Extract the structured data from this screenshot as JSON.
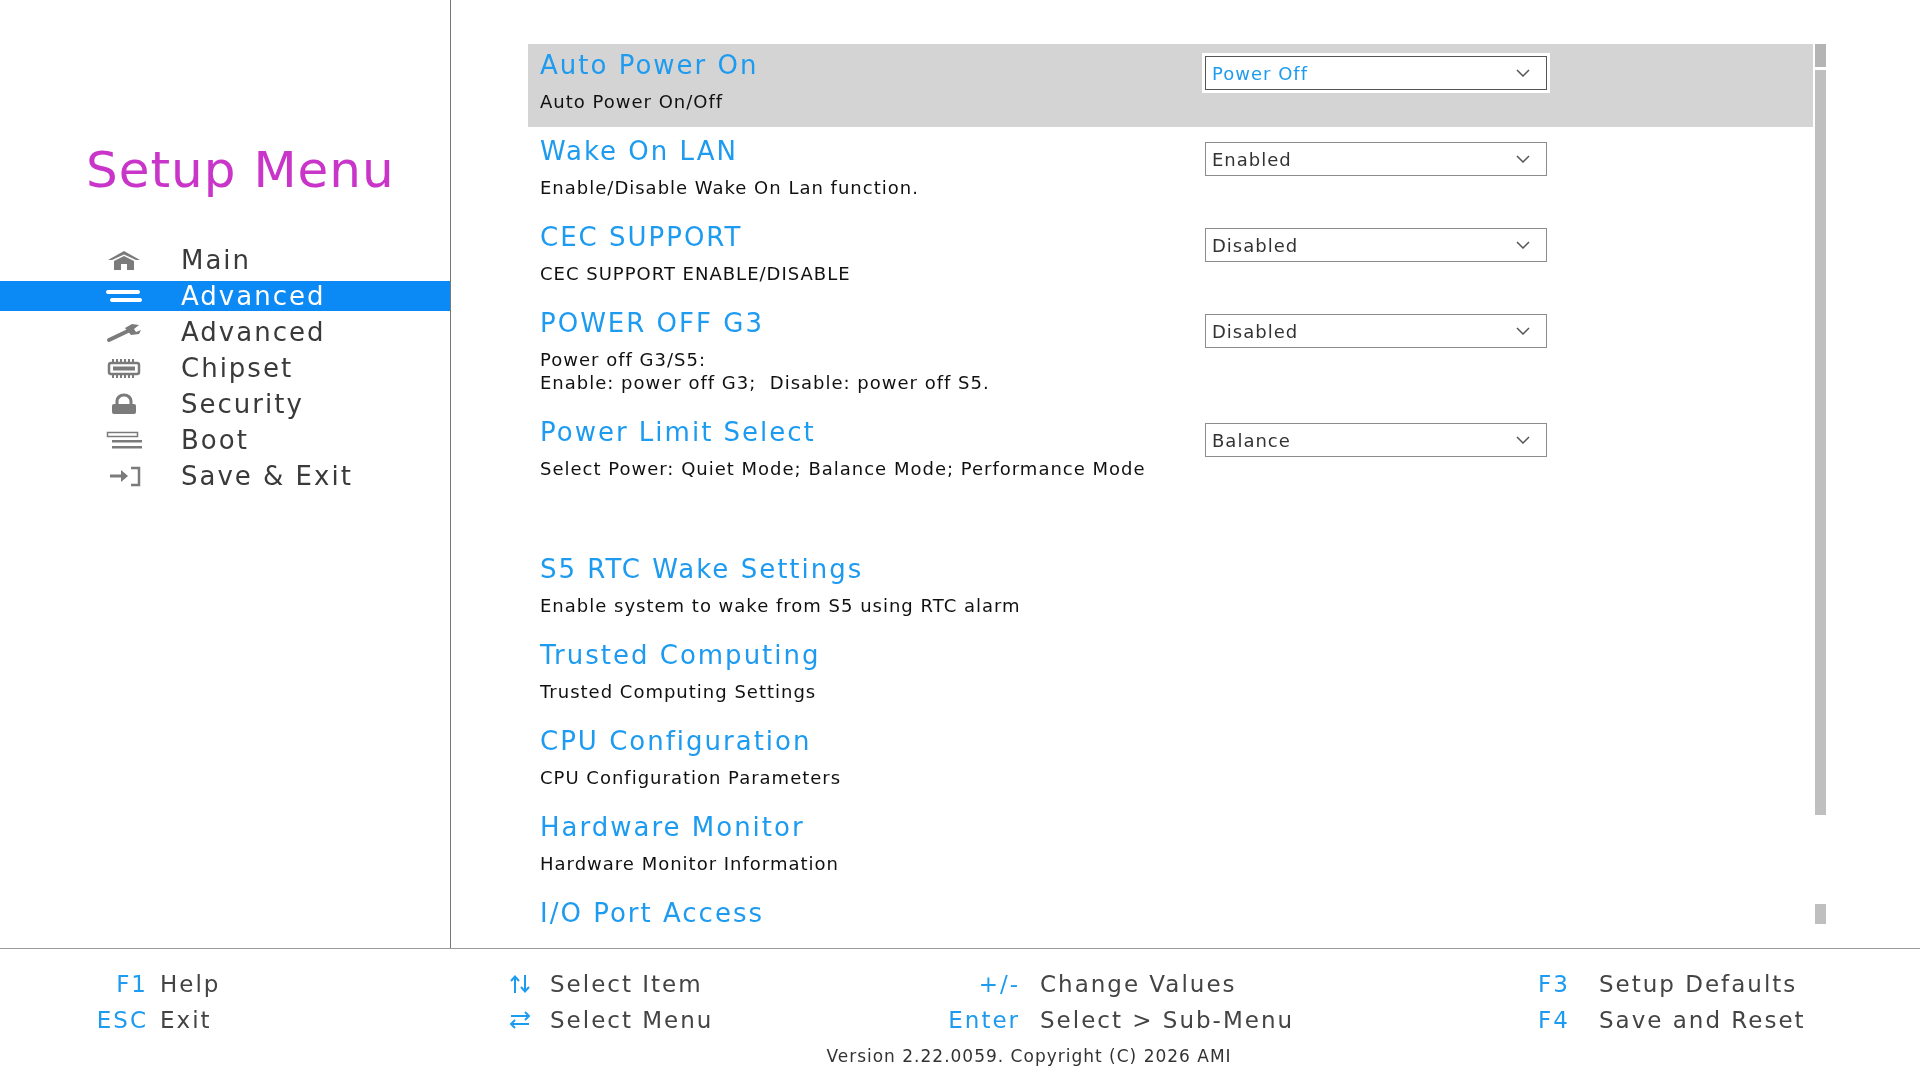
{
  "sidebar": {
    "title": "Setup Menu",
    "items": [
      {
        "label": "Main",
        "selected": false
      },
      {
        "label": "Advanced",
        "selected": true
      },
      {
        "label": "Advanced",
        "selected": false
      },
      {
        "label": "Chipset",
        "selected": false
      },
      {
        "label": "Security",
        "selected": false
      },
      {
        "label": "Boot",
        "selected": false
      },
      {
        "label": "Save & Exit",
        "selected": false
      }
    ]
  },
  "main": {
    "items": [
      {
        "kind": "setting",
        "title": "Auto Power On",
        "description": [
          "Auto Power On/Off"
        ],
        "value": "Power Off",
        "selected": true
      },
      {
        "kind": "setting",
        "title": "Wake On LAN",
        "description": [
          "Enable/Disable Wake On Lan function."
        ],
        "value": "Enabled",
        "selected": false
      },
      {
        "kind": "setting",
        "title": "CEC SUPPORT",
        "description": [
          "CEC SUPPORT ENABLE/DISABLE"
        ],
        "value": "Disabled",
        "selected": false
      },
      {
        "kind": "setting",
        "title": "POWER OFF G3",
        "description": [
          "Power off G3/S5:",
          "Enable: power off G3;  Disable: power off S5."
        ],
        "value": "Disabled",
        "selected": false
      },
      {
        "kind": "setting",
        "title": "Power Limit Select",
        "description": [
          "Select Power: Quiet Mode; Balance Mode; Performance Mode"
        ],
        "value": "Balance",
        "selected": false
      },
      {
        "kind": "submenu",
        "title": "S5 RTC Wake Settings",
        "description": [
          "Enable system to wake from S5 using RTC alarm"
        ],
        "selected": false
      },
      {
        "kind": "submenu",
        "title": "Trusted Computing",
        "description": [
          "Trusted Computing Settings"
        ],
        "selected": false
      },
      {
        "kind": "submenu",
        "title": "CPU Configuration",
        "description": [
          "CPU Configuration Parameters"
        ],
        "selected": false
      },
      {
        "kind": "submenu",
        "title": "Hardware Monitor",
        "description": [
          "Hardware Monitor Information"
        ],
        "selected": false
      },
      {
        "kind": "submenu",
        "title": "I/O Port Access",
        "selected": false
      }
    ]
  },
  "footer": {
    "columns": [
      {
        "rows": [
          {
            "key": "F1",
            "action": "Help"
          },
          {
            "key": "ESC",
            "action": "Exit"
          }
        ]
      },
      {
        "rows": [
          {
            "action": "Select Item"
          },
          {
            "action": "Select Menu"
          }
        ]
      },
      {
        "rows": [
          {
            "key": "+/-",
            "action": "Change Values"
          },
          {
            "key": "Enter",
            "action": "Select > Sub-Menu"
          }
        ]
      },
      {
        "rows": [
          {
            "key": "F3",
            "action": "Setup Defaults"
          },
          {
            "key": "F4",
            "action": "Save and Reset"
          }
        ]
      }
    ],
    "version": "Version 2.22.0059. Copyright (C) 2026 AMI"
  }
}
